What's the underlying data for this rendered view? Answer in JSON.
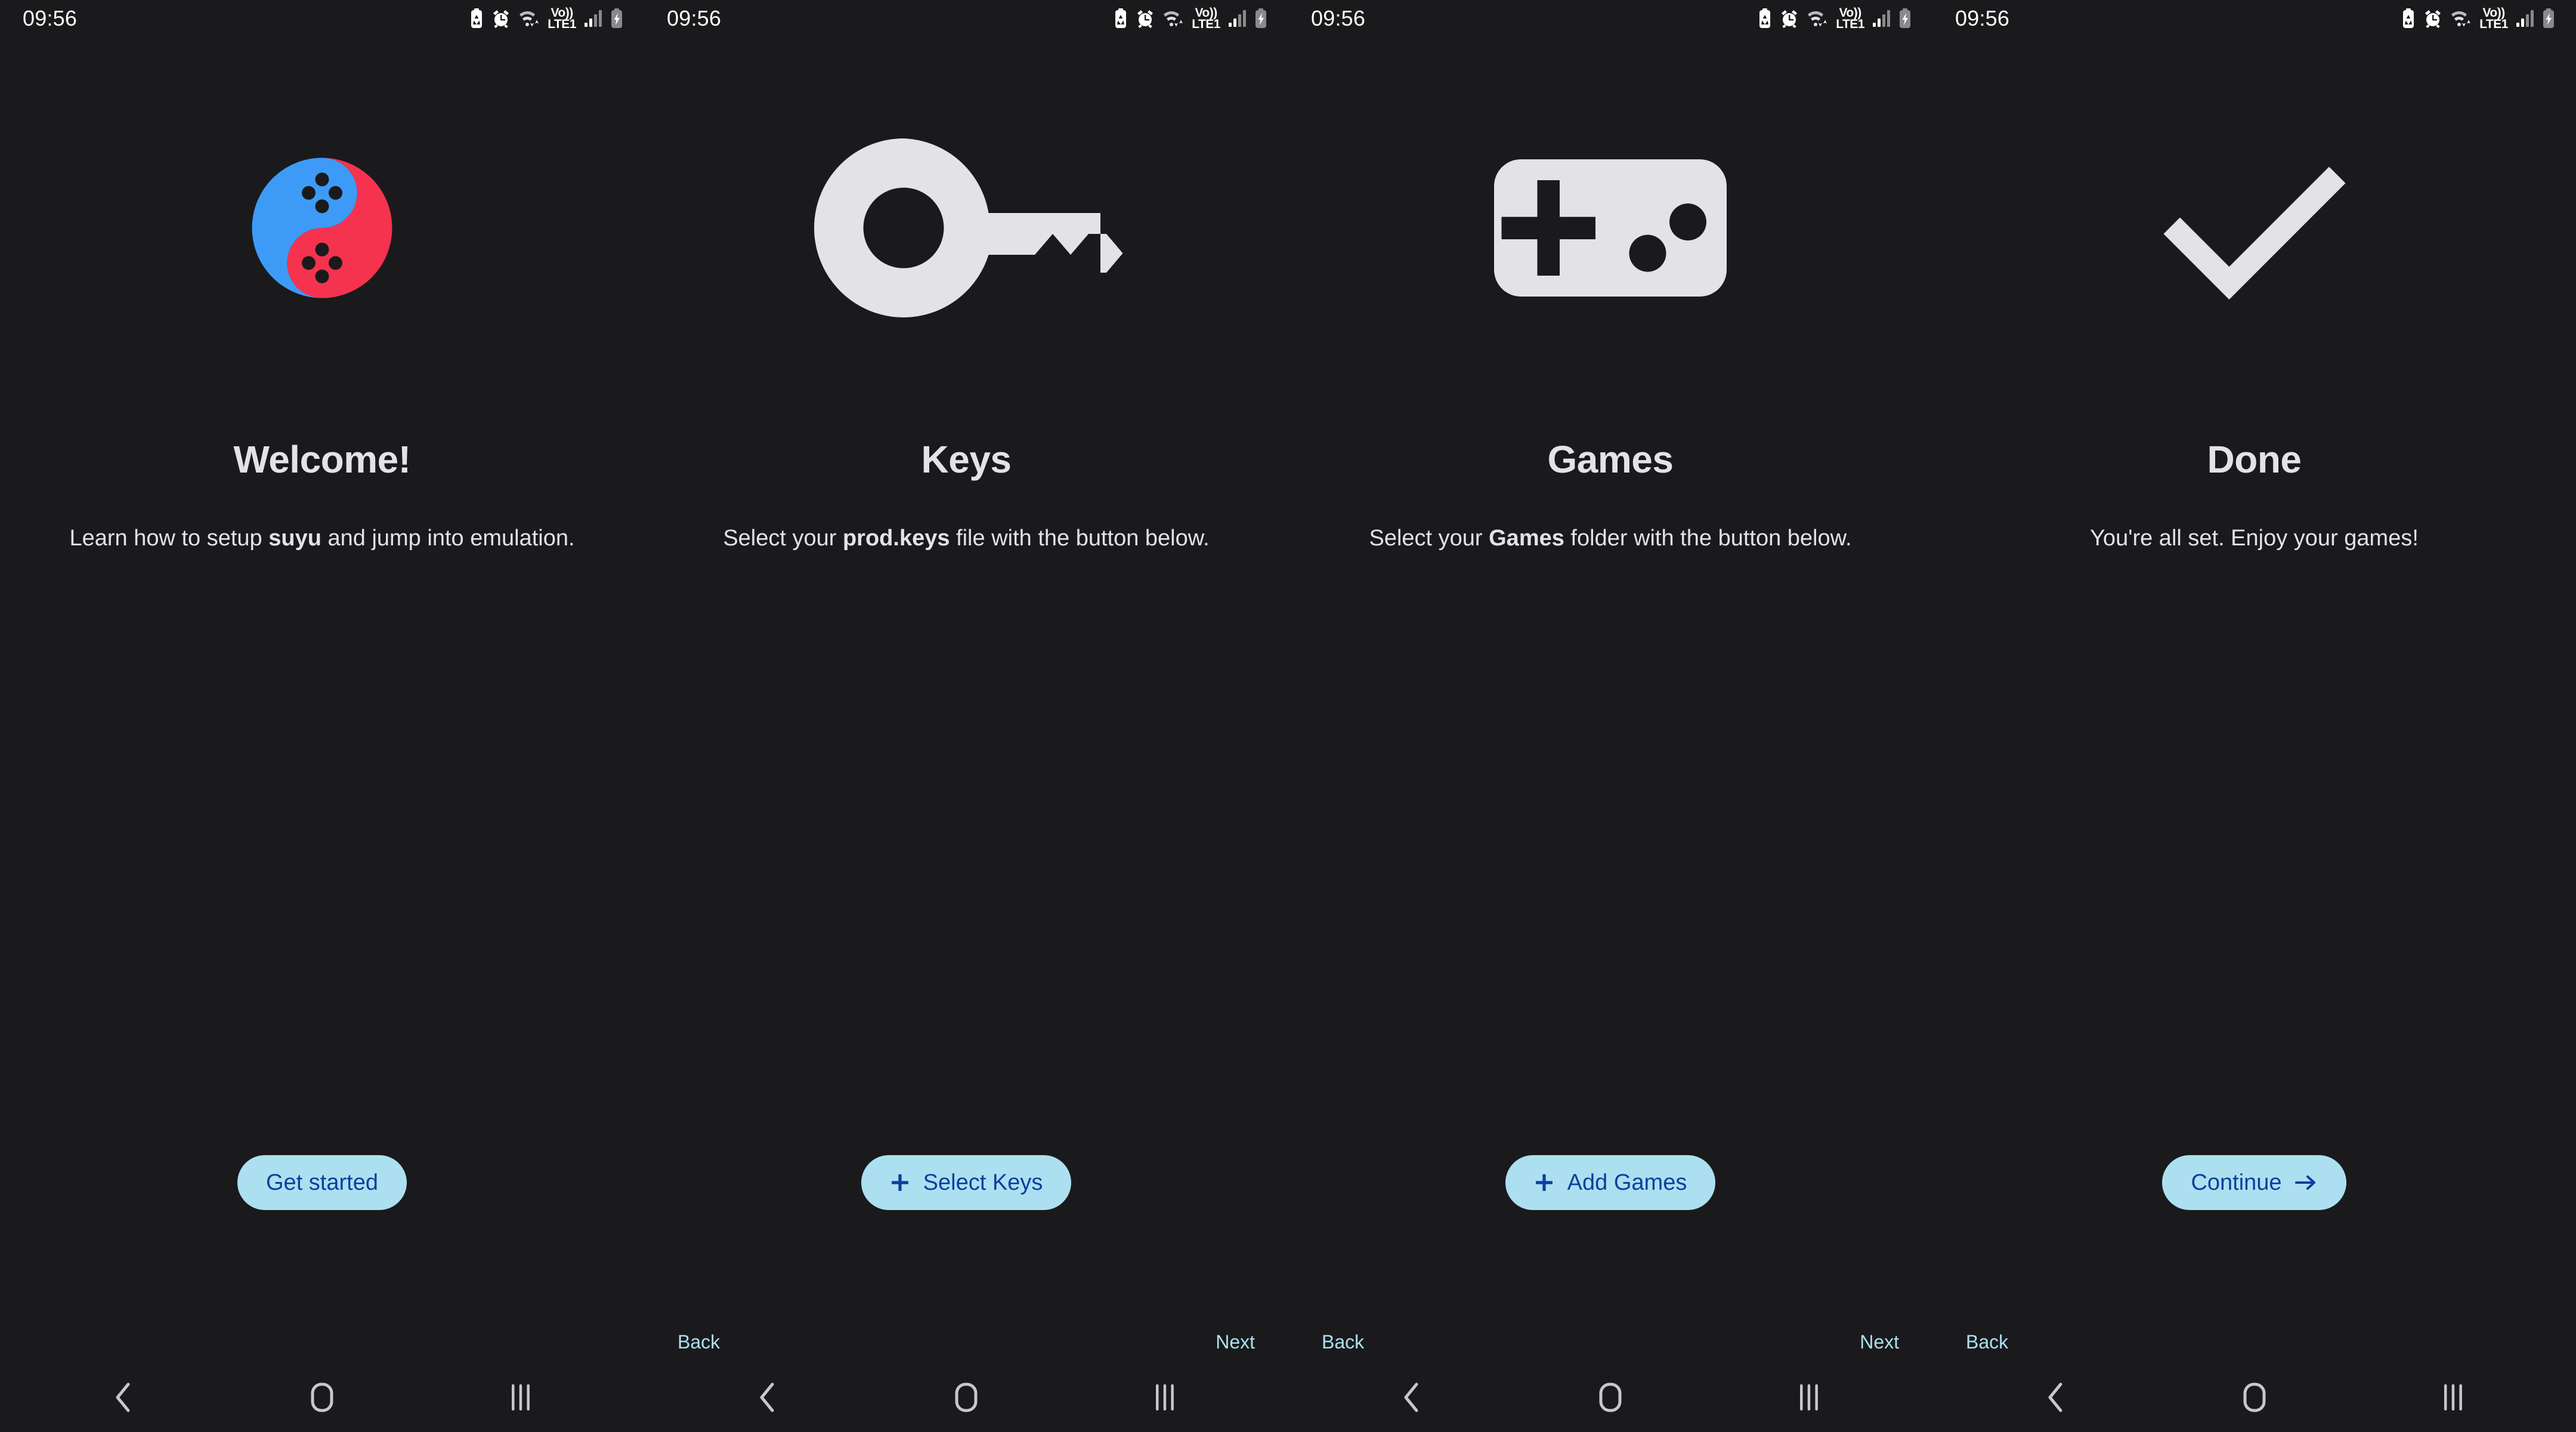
{
  "device": {
    "status_bar": {
      "clock": "09:56",
      "icons": [
        "battery-saver-icon",
        "alarm-icon",
        "wifi-transfer-icon",
        "volte-icon",
        "signal-bars-icon",
        "battery-charging-icon"
      ],
      "volte_top": "Vo))",
      "volte_bottom": "LTE1"
    },
    "nav_bar": {
      "back": "back-nav-icon",
      "home": "home-nav-icon",
      "recents": "recents-nav-icon"
    }
  },
  "colors": {
    "background": "#1a1a1c",
    "on_background": "#e3e2e6",
    "button_fill": "#ace0f0",
    "button_text": "#0c3f9e",
    "link": "#ace0f0",
    "logo_red": "#f5334f",
    "logo_blue": "#3d9bf7",
    "icon_fill": "#e3e2e6"
  },
  "screens": [
    {
      "id": "welcome",
      "art": "suyu-logo",
      "title": "Welcome!",
      "desc_parts": [
        {
          "text": "Learn how to setup ",
          "bold": false
        },
        {
          "text": "suyu",
          "bold": true
        },
        {
          "text": " and jump into emulation.",
          "bold": false
        }
      ],
      "button": {
        "label": "Get started",
        "icon": null
      },
      "nav": {
        "back": null,
        "next": null
      }
    },
    {
      "id": "keys",
      "art": "key-icon",
      "title": "Keys",
      "desc_parts": [
        {
          "text": "Select your ",
          "bold": false
        },
        {
          "text": "prod.keys",
          "bold": true
        },
        {
          "text": " file with the button below.",
          "bold": false
        }
      ],
      "button": {
        "label": "Select Keys",
        "icon": "plus-icon"
      },
      "nav": {
        "back": "Back",
        "next": "Next"
      }
    },
    {
      "id": "games",
      "art": "gamepad-icon",
      "title": "Games",
      "desc_parts": [
        {
          "text": "Select your ",
          "bold": false
        },
        {
          "text": "Games",
          "bold": true
        },
        {
          "text": " folder with the button below.",
          "bold": false
        }
      ],
      "button": {
        "label": "Add Games",
        "icon": "plus-icon"
      },
      "nav": {
        "back": "Back",
        "next": "Next"
      }
    },
    {
      "id": "done",
      "art": "check-icon",
      "title": "Done",
      "desc_parts": [
        {
          "text": "You're all set. Enjoy your games!",
          "bold": false
        }
      ],
      "button": {
        "label": "Continue",
        "icon": "arrow-right-icon"
      },
      "nav": {
        "back": "Back",
        "next": null
      }
    }
  ]
}
